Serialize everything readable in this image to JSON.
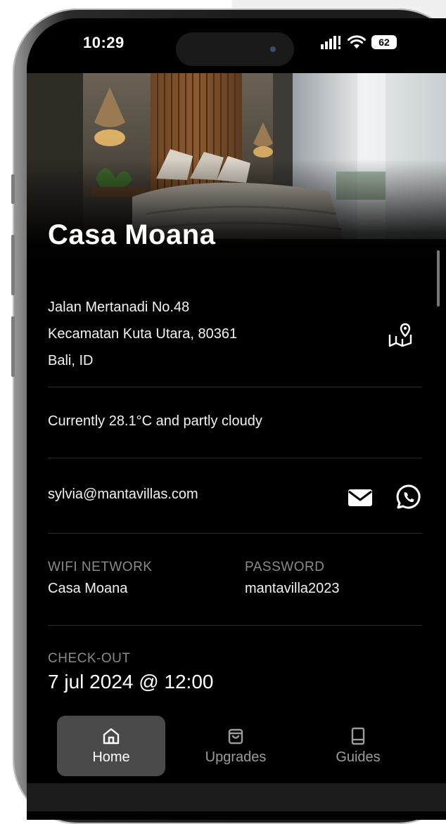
{
  "status_bar": {
    "time": "10:29",
    "battery": "62",
    "cellular_icon": "cellular-signal-icon",
    "wifi_icon": "wifi-icon"
  },
  "property": {
    "name": "Casa Moana",
    "address_line1": "Jalan Mertanadi No.48",
    "address_line2": "Kecamatan Kuta Utara, 80361",
    "address_line3": "Bali, ID",
    "map_icon": "map-pin-icon"
  },
  "weather": {
    "text": "Currently 28.1°C and partly cloudy"
  },
  "contact": {
    "email": "sylvia@mantavillas.com",
    "email_icon": "mail-icon",
    "whatsapp_icon": "whatsapp-icon"
  },
  "wifi": {
    "network_label": "WIFI NETWORK",
    "network_value": "Casa Moana",
    "password_label": "PASSWORD",
    "password_value": "mantavilla2023"
  },
  "checkout": {
    "label": "CHECK-OUT",
    "value": "7 jul 2024 @ 12:00"
  },
  "nav": {
    "items": [
      {
        "label": "Home",
        "icon": "home-icon",
        "active": true
      },
      {
        "label": "Upgrades",
        "icon": "shopping-bag-icon",
        "active": false
      },
      {
        "label": "Guides",
        "icon": "book-icon",
        "active": false
      }
    ]
  },
  "colors": {
    "background": "#000000",
    "text": "#ffffff",
    "muted": "#8a8a8a",
    "active_tab": "#4a4a4a"
  }
}
